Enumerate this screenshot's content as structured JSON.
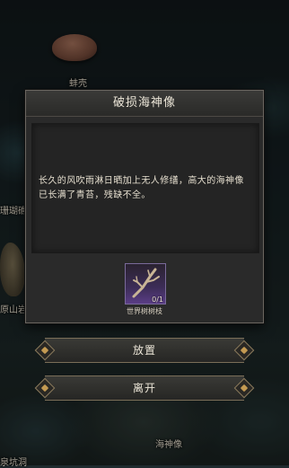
{
  "map": {
    "labels": {
      "shell": "蚌壳",
      "coral": "珊瑚礁",
      "rock": "原山岩",
      "cave": "泉坑洞",
      "statue": "海神像"
    }
  },
  "dialog": {
    "title": "破损海神像",
    "description": "长久的风吹雨淋日晒加上无人修缮，高大的海神像已长满了青苔，残缺不全。",
    "required_item": {
      "name": "世界树树枝",
      "count": "0/1",
      "icon": "branch-icon"
    }
  },
  "actions": {
    "place_label": "放置",
    "leave_label": "离开"
  },
  "colors": {
    "panel_bg": "#2a2a2a",
    "text": "#ece6d8",
    "item_slot": "#5a3d86",
    "button_trim": "#c49a52"
  }
}
